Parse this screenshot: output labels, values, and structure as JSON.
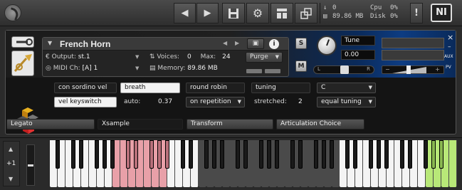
{
  "toolbar": {
    "prev_icon": "chevron-left-icon",
    "next_icon": "chevron-right-icon",
    "save_icon": "floppy-disk-icon",
    "settings_icon": "gear-icon",
    "view_icon": "layout-icon",
    "resize_icon": "resize-icon",
    "midi_count": "0",
    "memory": "89.86 MB",
    "cpu_label": "Cpu",
    "cpu_value": "0%",
    "disk_label": "Disk",
    "disk_value": "0%",
    "alert": "!",
    "brand": "NI"
  },
  "instrument": {
    "name": "French Horn",
    "output_label": "Output:",
    "output_value": "st.1",
    "voices_label": "Voices:",
    "voices_value": "0",
    "max_label": "Max:",
    "max_value": "24",
    "purge_label": "Purge",
    "midi_label": "MIDI Ch:",
    "midi_value": "[A]  1",
    "memory_label": "Memory:",
    "memory_value": "89.86 MB",
    "solo_label": "S",
    "mute_label": "M",
    "tune_label": "Tune",
    "tune_value": "0.00",
    "pan_left": "L",
    "pan_right": "R",
    "aux_label": "AUX",
    "pv_label": "PV",
    "close_label": "×",
    "minimize_label": "–",
    "vol_minus": "−",
    "vol_plus": "+",
    "info_label": "i"
  },
  "script": {
    "con_sordino": "con sordino vel",
    "breath": "breath",
    "round_robin": "round robin",
    "tuning": "tuning",
    "key_menu": "C",
    "vel_keyswitch": "vel keyswitch",
    "auto_label": "auto:",
    "auto_value": "0.37",
    "repetition_menu": "on repetition",
    "stretched_label": "stretched:",
    "stretched_value": "2",
    "tuning_menu": "equal tuning"
  },
  "tabs": [
    "Legato",
    "Xsample",
    "Transform",
    "Articulation Choice"
  ],
  "keyboard": {
    "octave_value": "+1",
    "octave_up": "▲",
    "octave_down": "▼",
    "colors": {
      "white": "#f4f4f4",
      "black": "#1a1a1a",
      "range": "#e8a0a8",
      "range_black": "#b8707a",
      "unused": "#4a4a4a",
      "keyswitch": "#b8e878",
      "keyswitch_black": "#8ab850"
    }
  }
}
